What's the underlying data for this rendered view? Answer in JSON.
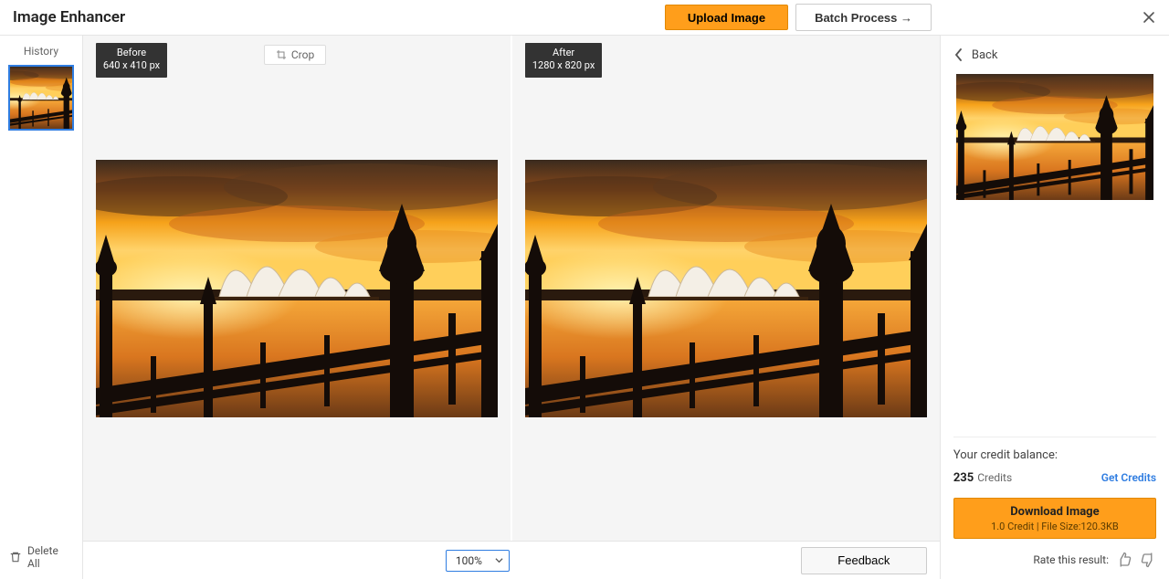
{
  "header": {
    "title": "Image Enhancer",
    "upload_label": "Upload Image",
    "batch_label": "Batch Process →"
  },
  "sidebar": {
    "history_label": "History",
    "delete_all_label": "Delete All"
  },
  "compare": {
    "before_label": "Before",
    "before_dims": "640 x 410 px",
    "after_label": "After",
    "after_dims": "1280 x 820 px",
    "crop_label": "Crop"
  },
  "bottom": {
    "zoom": "100%",
    "feedback_label": "Feedback"
  },
  "rail": {
    "back_label": "Back",
    "credit_balance_label": "Your credit balance:",
    "credits_count": "235",
    "credits_word": "Credits",
    "get_credits_label": "Get Credits",
    "download_label": "Download Image",
    "download_sub": "1.0 Credit | File Size:120.3KB",
    "rate_label": "Rate this result:"
  }
}
